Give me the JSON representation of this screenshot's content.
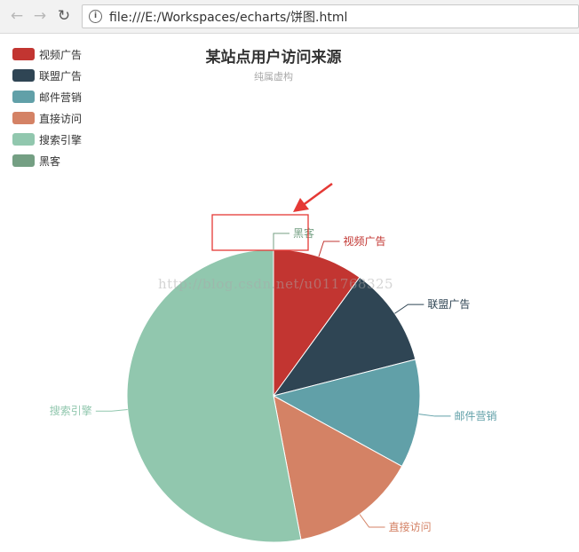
{
  "browser": {
    "back_icon": "back-arrow-icon",
    "forward_icon": "forward-arrow-icon",
    "reload_icon": "reload-icon",
    "info_icon": "info-icon",
    "url": "file:///E:/Workspaces/echarts/饼图.html"
  },
  "watermark": "http://blog.csdn.net/u011768325",
  "annotation": {
    "color": "#e53935",
    "highlight": "黑客"
  },
  "chart_data": {
    "type": "pie",
    "title": "某站点用户访问来源",
    "subtitle": "纯属虚构",
    "legend_position": "top-left",
    "start_angle_deg": 90,
    "clockwise": true,
    "slices": [
      {
        "name": "视频广告",
        "value": 10,
        "color": "#c23531"
      },
      {
        "name": "联盟广告",
        "value": 11,
        "color": "#2f4554"
      },
      {
        "name": "邮件营销",
        "value": 12,
        "color": "#61a0a8"
      },
      {
        "name": "直接访问",
        "value": 14,
        "color": "#d48265"
      },
      {
        "name": "搜索引擎",
        "value": 53,
        "color": "#91c7ae"
      },
      {
        "name": "黑客",
        "value": 0,
        "color": "#749f83"
      }
    ]
  }
}
